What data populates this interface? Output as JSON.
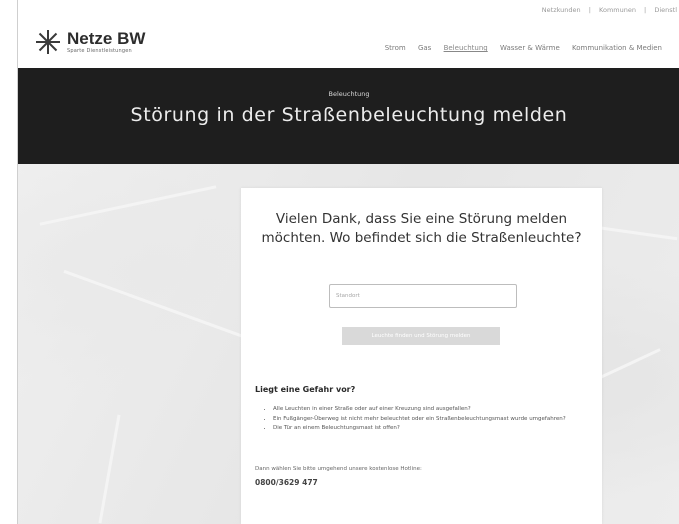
{
  "header": {
    "logo_name": "Netze BW",
    "logo_sub": "Sparte Dienstleistungen",
    "top_links": [
      "Netzkunden",
      "Kommunen",
      "Dienstl"
    ],
    "top_sep": "|",
    "nav": [
      "Strom",
      "Gas",
      "Beleuchtung",
      "Wasser & Wärme",
      "Kommunikation & Medien"
    ]
  },
  "hero": {
    "category": "Beleuchtung",
    "title": "Störung in der Straßenbeleuchtung melden"
  },
  "card": {
    "question_line1": "Vielen Dank, dass Sie eine Störung melden",
    "question_line2": "möchten. Wo befindet sich die Straßenleuchte?",
    "input_placeholder": "Standort",
    "button_label": "Leuchte finden und Störung melden",
    "danger_title": "Liegt eine Gefahr vor?",
    "danger_items": [
      "Alle Leuchten in einer Straße oder auf einer Kreuzung sind ausgefallen?",
      "Ein Fußgänger-Überweg ist nicht mehr beleuchtet oder ein Straßenbeleuchtungsmast wurde umgefahren?",
      "Die Tür an einem Beleuchtungsmast ist offen?"
    ],
    "hotline_note": "Dann wählen Sie bitte umgehend unsere kostenlose Hotline:",
    "hotline_number": "0800/3629 477"
  }
}
